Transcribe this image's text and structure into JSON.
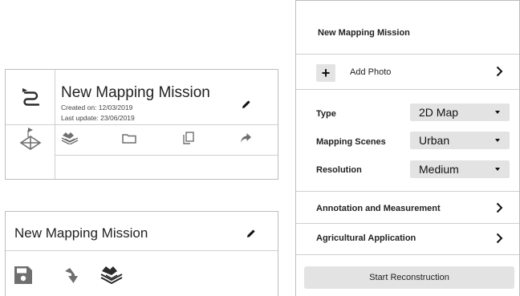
{
  "card_detail": {
    "title": "New Mapping Mission",
    "created": "Created on: 12/03/2019",
    "updated": "Last update: 23/06/2019"
  },
  "card_compact": {
    "title": "New Mapping Mission"
  },
  "panel": {
    "title": "New Mapping Mission",
    "add_photo_label": "Add Photo",
    "add_photo_symbol": "+",
    "fields": [
      {
        "label": "Type",
        "value": "2D Map"
      },
      {
        "label": "Mapping Scenes",
        "value": "Urban"
      },
      {
        "label": "Resolution",
        "value": "Medium"
      }
    ],
    "nav": [
      {
        "label": "Annotation and Measurement"
      },
      {
        "label": "Agricultural Application"
      }
    ],
    "start_label": "Start Reconstruction"
  },
  "icons": [
    "route-icon",
    "pencil-icon",
    "waypoint-icon",
    "map-layers-icon",
    "folder-icon",
    "copy-icon",
    "share-icon",
    "save-icon",
    "download-icon",
    "chevron-right-icon"
  ],
  "colors": {
    "icon_dark": "#2b2b2b",
    "icon_gray": "#6f6f6f",
    "control_bg": "#e3e3e3",
    "border": "#bdbdbd"
  }
}
